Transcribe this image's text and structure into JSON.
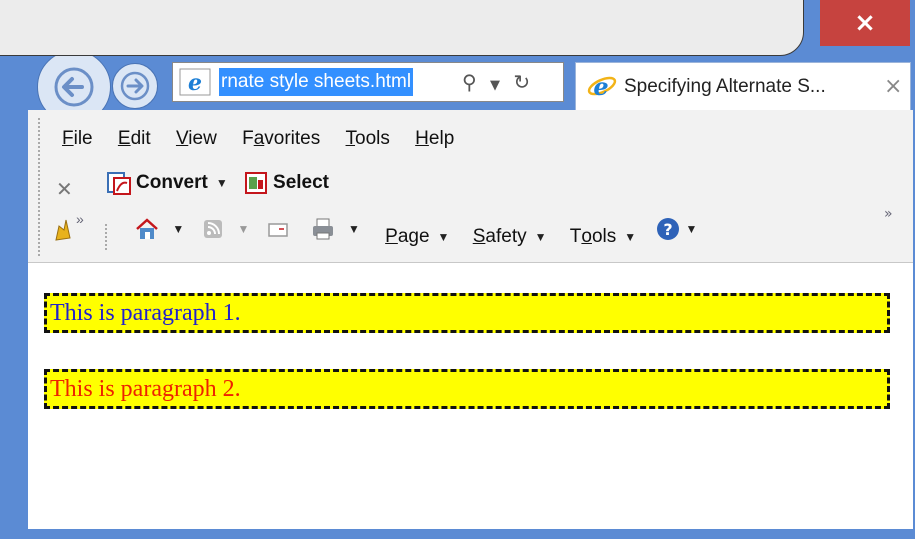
{
  "browser": {
    "address_url": "rnate style sheets.html",
    "tab_title": "Specifying Alternate S...",
    "tab_close": "×",
    "close_glyph": "×"
  },
  "menu": {
    "items": [
      {
        "acc": "F",
        "rest": "ile"
      },
      {
        "acc": "E",
        "rest": "dit"
      },
      {
        "acc": "V",
        "rest": "iew"
      },
      {
        "pre": "F",
        "acc": "a",
        "rest": "vorites"
      },
      {
        "acc": "T",
        "rest": "ools"
      },
      {
        "acc": "H",
        "rest": "elp"
      }
    ]
  },
  "commandbar": {
    "convert_label": "Convert",
    "select_label": "Select",
    "page_label": {
      "acc": "P",
      "rest": "age"
    },
    "safety_label": {
      "acc": "S",
      "rest": "afety"
    },
    "tools_label": {
      "pre": "T",
      "acc": "o",
      "rest": "ols"
    },
    "chevron": "»"
  },
  "content": {
    "paragraph_1": "This is paragraph 1.",
    "paragraph_2": "This is paragraph 2."
  },
  "colors": {
    "frame": "#5b8bd4",
    "close_button": "#c6433f",
    "paragraph_bg": "#ffff00",
    "paragraph_1_text": "#2222cc",
    "paragraph_2_text": "#ee2200",
    "url_highlight": "#3390ff"
  }
}
